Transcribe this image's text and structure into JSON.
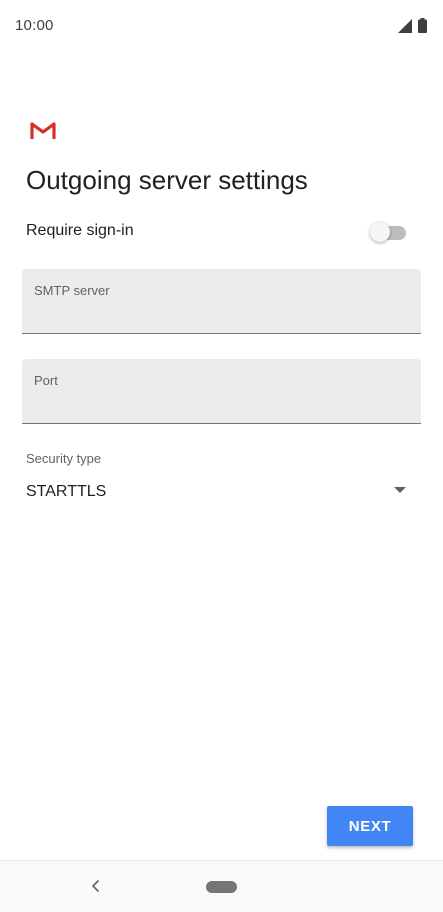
{
  "status_bar": {
    "time": "10:00",
    "icons": [
      "signal-icon",
      "battery-icon"
    ]
  },
  "app": {
    "logo": "gmail-logo"
  },
  "page": {
    "title": "Outgoing server settings"
  },
  "require_signin": {
    "label": "Require sign-in",
    "enabled": false
  },
  "smtp_server": {
    "label": "SMTP server",
    "value": ""
  },
  "port": {
    "label": "Port",
    "value": ""
  },
  "security_type": {
    "label": "Security type",
    "value": "STARTTLS"
  },
  "actions": {
    "next_label": "NEXT"
  },
  "nav_bar": {
    "icons": [
      "back-icon",
      "home-pill"
    ]
  },
  "colors": {
    "accent": "#4285f4",
    "field_bg": "#ececec",
    "gmail_red": "#d93025"
  }
}
